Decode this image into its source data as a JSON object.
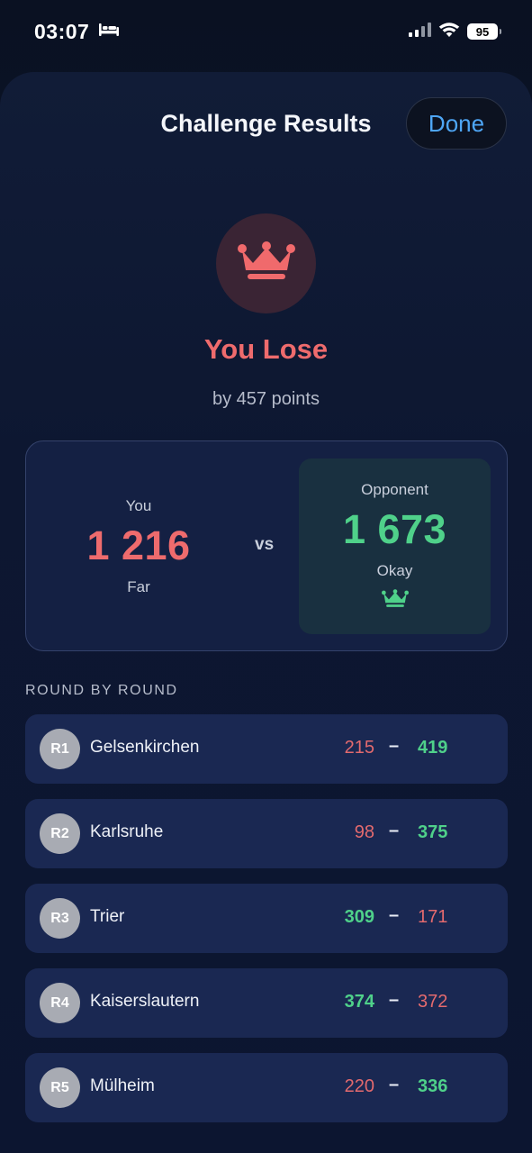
{
  "status_bar": {
    "time": "03:07",
    "battery": "95",
    "icons": [
      "bed-icon",
      "signal-icon",
      "wifi-icon",
      "battery-icon"
    ]
  },
  "header": {
    "title": "Challenge Results",
    "done_label": "Done"
  },
  "result": {
    "icon": "crown-icon",
    "title": "You Lose",
    "subtitle": "by 457 points",
    "accent_color": "#ee6b6d"
  },
  "score_card": {
    "you": {
      "label": "You",
      "score": "1 216",
      "rating": "Far"
    },
    "vs": "vs",
    "opponent": {
      "label": "Opponent",
      "score": "1 673",
      "rating": "Okay",
      "icon": "crown-icon"
    },
    "win_color": "#4fd18a"
  },
  "rounds_section": {
    "title": "ROUND BY ROUND",
    "rounds": [
      {
        "badge": "R1",
        "city": "Gelsenkirchen",
        "you": "215",
        "opponent": "419",
        "you_won": false
      },
      {
        "badge": "R2",
        "city": "Karlsruhe",
        "you": "98",
        "opponent": "375",
        "you_won": false
      },
      {
        "badge": "R3",
        "city": "Trier",
        "you": "309",
        "opponent": "171",
        "you_won": true
      },
      {
        "badge": "R4",
        "city": "Kaiserslautern",
        "you": "374",
        "opponent": "372",
        "you_won": true
      },
      {
        "badge": "R5",
        "city": "Mülheim",
        "you": "220",
        "opponent": "336",
        "you_won": false
      }
    ],
    "separator": "–"
  }
}
